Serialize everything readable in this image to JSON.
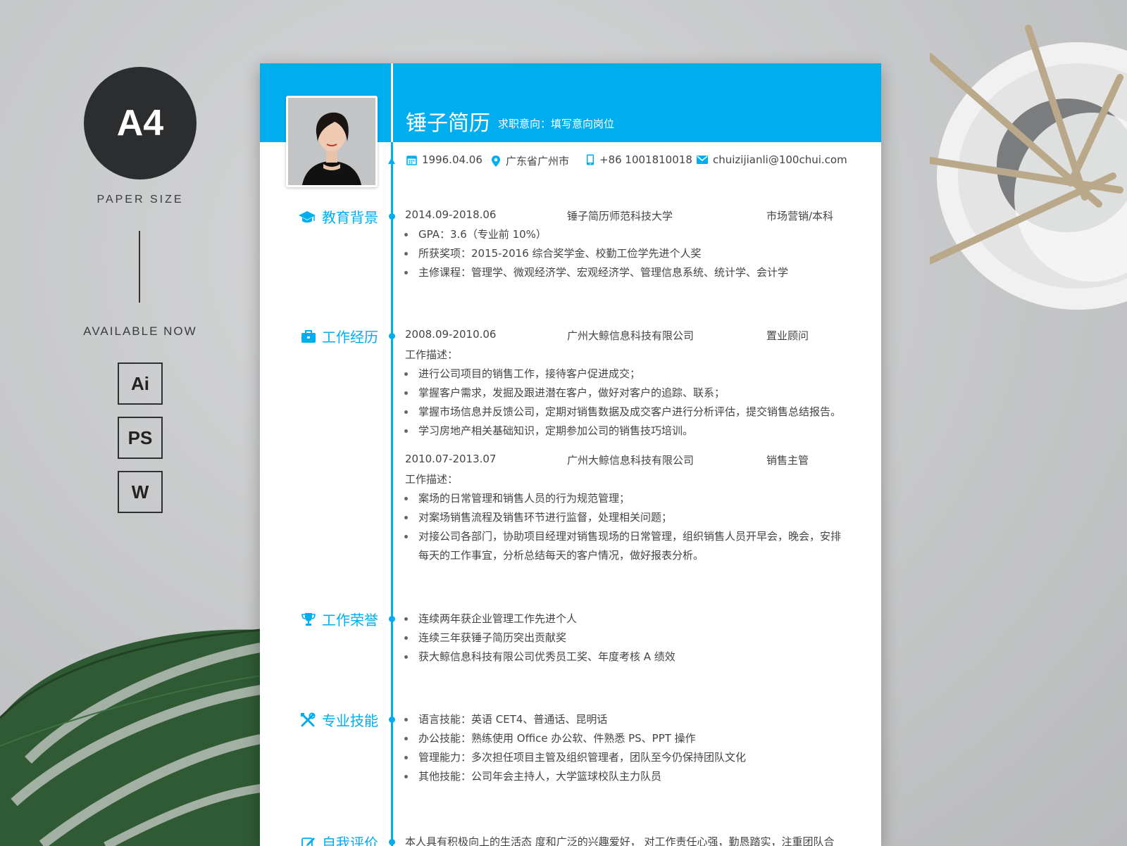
{
  "branding": {
    "format": "A4",
    "paper_size": "PAPER SIZE",
    "available": "AVAILABLE NOW",
    "apps": [
      "Ai",
      "PS",
      "W"
    ]
  },
  "colors": {
    "accent": "#00aef0",
    "text": "#444444",
    "background": "#cfd0d1"
  },
  "resume": {
    "name": "锤子简历",
    "intention": "求职意向：填写意向岗位",
    "contact": {
      "birthday": "1996.04.06",
      "location": "广东省广州市",
      "phone": "+86 1001810018",
      "email": "chuizijianli@100chui.com"
    },
    "sections": {
      "education": {
        "title": "教育背景",
        "period": "2014.09-2018.06",
        "school": "锤子简历师范科技大学",
        "major": "市场营销/本科",
        "items": [
          "GPA：3.6（专业前 10%）",
          "所获奖项：2015-2016 综合奖学金、校勤工俭学先进个人奖",
          "主修课程：管理学、微观经济学、宏观经济学、管理信息系统、统计学、会计学"
        ]
      },
      "work": {
        "title": "工作经历",
        "jobs": [
          {
            "period": "2008.09-2010.06",
            "company": "广州大鲸信息科技有限公司",
            "position": "置业顾问",
            "desc_label": "工作描述：",
            "items": [
              "进行公司项目的销售工作，接待客户促进成交；",
              "掌握客户需求，发掘及跟进潜在客户，做好对客户的追踪、联系；",
              "掌握市场信息并反馈公司，定期对销售数据及成交客户进行分析评估，提交销售总结报告。",
              "学习房地产相关基础知识，定期参加公司的销售技巧培训。"
            ]
          },
          {
            "period": "2010.07-2013.07",
            "company": "广州大鲸信息科技有限公司",
            "position": "销售主管",
            "desc_label": "工作描述：",
            "items": [
              "案场的日常管理和销售人员的行为规范管理；",
              "对案场销售流程及销售环节进行监督，处理相关问题；",
              "对接公司各部门，协助项目经理对销售现场的日常管理，组织销售人员开早会，晚会，安排"
            ],
            "continuation": "每天的工作事宜，分析总结每天的客户情况，做好报表分析。"
          }
        ]
      },
      "honors": {
        "title": "工作荣誉",
        "items": [
          "连续两年获企业管理工作先进个人",
          "连续三年获锤子简历突出贡献奖",
          "获大鲸信息科技有限公司优秀员工奖、年度考核 A 绩效"
        ]
      },
      "skills": {
        "title": "专业技能",
        "items": [
          "语言技能：英语 CET4、普通话、昆明话",
          "办公技能：熟练使用 Office 办公软、件熟悉 PS、PPT 操作",
          "管理能力：多次担任项目主管及组织管理者，团队至今仍保持团队文化",
          "其他技能：公司年会主持人，大学篮球校队主力队员"
        ]
      },
      "self_eval": {
        "title": "自我评价",
        "text": "本人具有积极向上的生活态  度和广泛的兴趣爱好，  对工作责任心强，勤恳踏实，注重团队合"
      }
    }
  }
}
